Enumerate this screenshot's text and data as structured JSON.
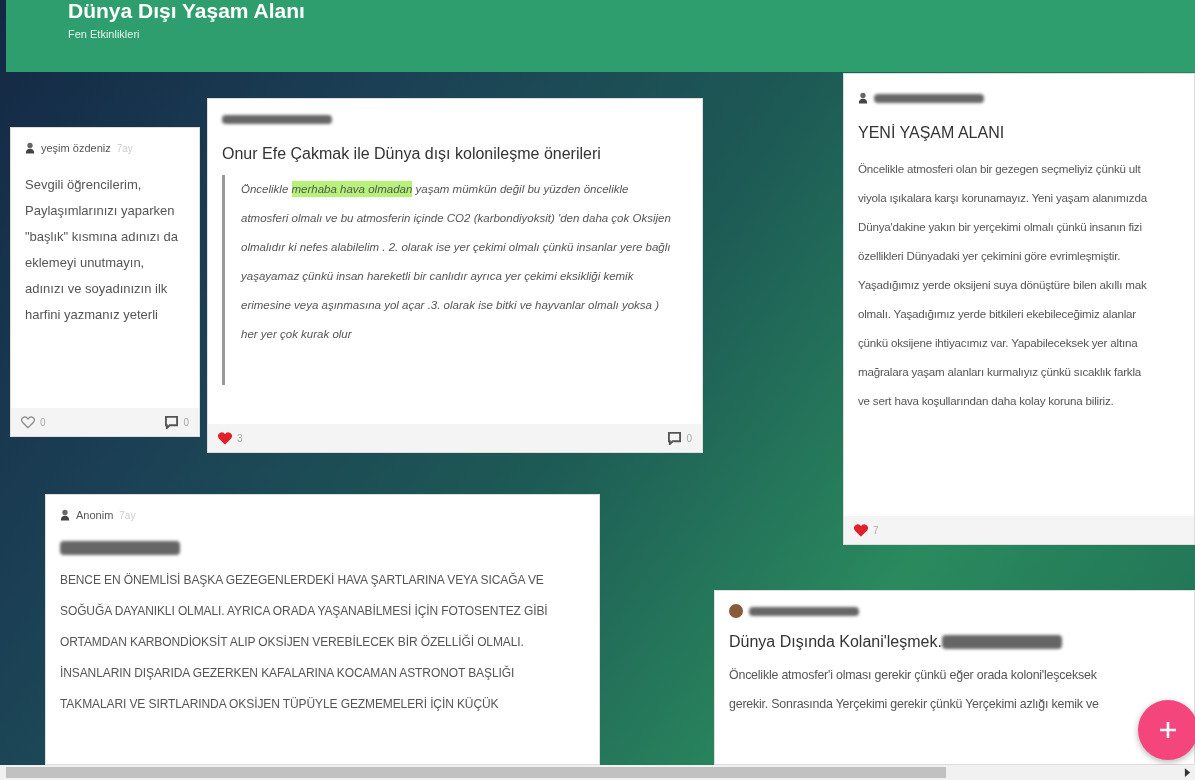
{
  "board": {
    "title": "Dünya Dışı Yaşam Alanı",
    "subtitle": "Fen Etkinlikleri"
  },
  "posts": [
    {
      "author": {
        "avatar": {
          "kind": "person"
        },
        "name": "yeşim özdeniz",
        "time": "7ay",
        "name_redacted": false
      },
      "body": {
        "kind": "lines"
      },
      "lines": [
        "Sevgili öğrencilerim,",
        "Paylaşımlarınızı yaparken",
        "\"başlık\" kısmına adınızı da",
        "eklemeyi unutmayın,",
        "adınızı ve soyadınızın ilk",
        "harfini yazmanız yeterli"
      ],
      "likes": {
        "count": "0",
        "liked": false
      },
      "comments": {
        "count": "0"
      }
    },
    {
      "author": {
        "name_redacted": true
      },
      "title": "Onur Efe Çakmak ile Dünya dışı kolonileşme önerileri",
      "body": {
        "kind": "quote"
      },
      "segments": [
        {
          "text": "Öncelikle ",
          "highlighted": false
        },
        {
          "text": "merhaba  hava olmadan",
          "highlighted": true
        },
        {
          "text": " yaşam mümkün değil bu yüzden öncelikle atmosferi olmalı ve bu atmosferin içinde CO2 (karbondiyoksit) 'den daha çok Oksijen olmalıdır ki nefes alabilelim . 2. olarak  ise yer çekimi olmalı çünkü  insanlar yere bağlı yaşayamaz  çünkü  insan  hareketli bir canlıdır ayrıca yer çekimi eksikliği kemik erimesine veya aşınmasına yol açar .3. olarak ise bitki ve hayvanlar olmalı yoksa ) her yer çok kurak olur",
          "highlighted": false
        }
      ],
      "likes": {
        "count": "3",
        "liked": true
      },
      "comments": {
        "count": "0"
      }
    },
    {
      "author": {
        "avatar": {
          "kind": "person"
        },
        "name_redacted": true
      },
      "title": "YENİ YAŞAM ALANI",
      "body": {
        "kind": "lines"
      },
      "lines": [
        "Öncelikle atmosferi olan bir gezegen seçmeliyiz çünkü ult",
        "viyola ışıkalara karşı korunamayız. Yeni yaşam alanımızda",
        "Dünya'dakine yakın bir yerçekimi olmalı çünkü insanın fizi",
        "özellikleri Dünyadaki yer çekimini göre evrimleşmiştir.",
        "Yaşadığımız yerde oksijeni suya dönüştüre bilen akıllı mak",
        "olmalı. Yaşadığımız yerde bitkileri ekebileceğimiz alanlar",
        "çünkü oksijene ihtiyacımız var. Yapabileceksek yer altına",
        "mağralara yaşam alanları kurmalıyız çünkü sıcaklık farkla",
        "ve sert hava koşullarından daha kolay koruna biliriz."
      ],
      "likes": {
        "count": "7",
        "liked": true
      }
    },
    {
      "author": {
        "avatar": {
          "kind": "person"
        },
        "name": "Anonim",
        "time": "7ay",
        "name_redacted": false
      },
      "title_redacted": true,
      "body": {
        "kind": "lines"
      },
      "lines": [
        "BENCE EN ÖNEMLİSİ BAŞKA GEZEGENLERDEKİ HAVA ŞARTLARINA VEYA SICAĞA VE",
        "SOĞUĞA DAYANIKLI OLMALI. AYRICA ORADA YAŞANABİLMESİ İÇİN FOTOSENTEZ GİBİ",
        "ORTAMDAN KARBONDİOKSİT ALIP OKSİJEN VEREBİLECEK BİR ÖZELLİĞİ OLMALI.",
        "İNSANLARIN DIŞARIDA GEZERKEN KAFALARINA KOCAMAN ASTRONOT BAŞLIĞI",
        "TAKMALARI VE SIRTLARINDA OKSİJEN TÜPÜYLE GEZMEMELERİ İÇİN KÜÇÜK"
      ]
    },
    {
      "author": {
        "avatar": {
          "kind": "photo"
        },
        "name_redacted": true
      },
      "title": "Dünya Dışında Kolani'leşmek.",
      "title_redacted": true,
      "body": {
        "kind": "lines"
      },
      "lines": [
        "Öncelikle atmosfer'i olması gerekir çünkü eğer orada koloni'leşceksek",
        "gerekir. Sonrasında Yerçekimi gerekir çünkü Yerçekimi azlığı kemik ve"
      ]
    }
  ]
}
